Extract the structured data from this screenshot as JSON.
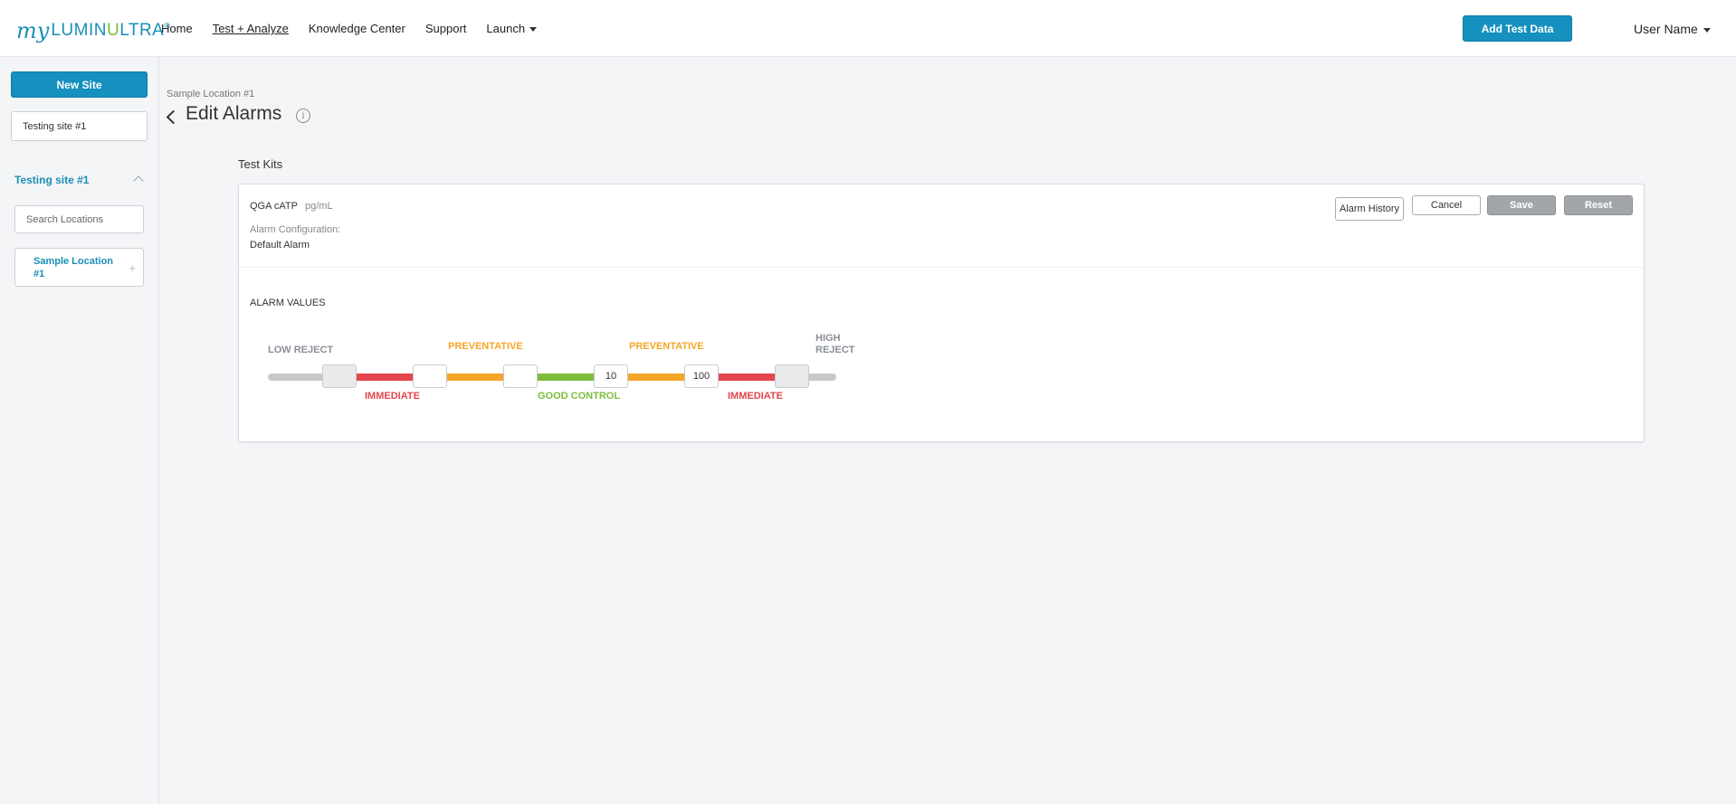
{
  "brand": {
    "my": "my",
    "name_a": "LUMIN",
    "name_u": "U",
    "name_b": "LTRA",
    "reg": "®"
  },
  "nav": {
    "items": [
      {
        "label": "Home"
      },
      {
        "label": "Test + Analyze"
      },
      {
        "label": "Knowledge Center"
      },
      {
        "label": "Support"
      },
      {
        "label": "Launch"
      }
    ],
    "add_test_data": "Add Test Data",
    "user_name": "User Name"
  },
  "sidebar": {
    "new_site": "New Site",
    "site_select": "Testing site #1",
    "site_heading": "Testing site #1",
    "search_placeholder": "Search Locations",
    "location": "Sample Location #1",
    "location_add_icon": "plus-icon"
  },
  "page": {
    "breadcrumb": "Sample Location #1",
    "title": "Edit Alarms",
    "info_icon": "i"
  },
  "test_kits": {
    "section_title": "Test Kits",
    "kit_name": "QGA cATP",
    "kit_unit": "pg/mL",
    "config_label": "Alarm Configuration:",
    "config_value": "Default Alarm",
    "buttons": {
      "alarm_history": "Alarm History",
      "cancel": "Cancel",
      "save": "Save",
      "reset": "Reset"
    },
    "alarm_values_title": "ALARM VALUES",
    "zones": {
      "low_reject": "LOW REJECT",
      "immediate_low": "IMMEDIATE",
      "preventative_low": "PREVENTATIVE",
      "good_control": "GOOD CONTROL",
      "preventative_high": "PREVENTATIVE",
      "immediate_high": "IMMEDIATE",
      "high_reject": "HIGH REJECT"
    },
    "thresholds": [
      "",
      "",
      "",
      "10",
      "100",
      ""
    ],
    "colors": {
      "grey": "#c8c8c8",
      "red": "#e4464e",
      "orange": "#f5a528",
      "green": "#7dbd3c",
      "accent": "#1590bf"
    }
  }
}
